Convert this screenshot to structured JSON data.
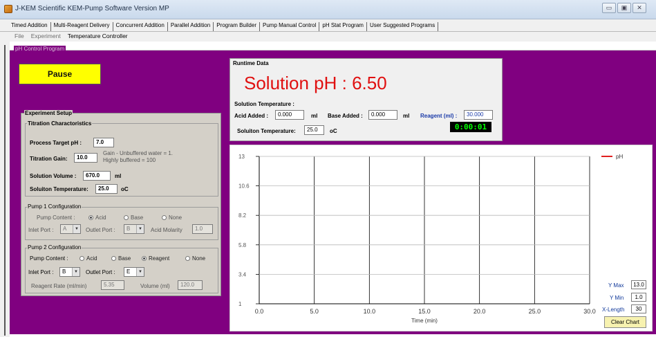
{
  "window": {
    "title": "J-KEM Scientific KEM-Pump Software  Version MP",
    "buttons": [
      "▭",
      "▣",
      "✕"
    ]
  },
  "tabs": [
    {
      "label": "Timed Addition"
    },
    {
      "label": "Multi-Reagent Delivery"
    },
    {
      "label": "Concurrent Addition"
    },
    {
      "label": "Parallel Addition"
    },
    {
      "label": "Program Builder"
    },
    {
      "label": "Pump Manual Control"
    },
    {
      "label": "pH Stat Program"
    },
    {
      "label": "User Suggested Programs"
    }
  ],
  "menu": [
    "File",
    "Experiment",
    "Temperature Controller"
  ],
  "group_title": "pH Control Program",
  "pause_label": "Pause",
  "setup": {
    "title": "Experiment Setup",
    "titration": {
      "title": "Titration Charactoristics",
      "target_label": "Process Target pH :",
      "target_value": "7.0",
      "gain_label": "Titration Gain:",
      "gain_value": "10.0",
      "gain_hint_1": "Gain - Unbuffered water = 1.",
      "gain_hint_2": "Highly buffered = 100",
      "volume_label": "Solution Volume :",
      "volume_value": "670.0",
      "volume_unit": "ml",
      "temp_label": "Soluiton Temperature:",
      "temp_value": "25.0",
      "temp_unit": "oC"
    },
    "pump1": {
      "title": "Pump 1 Configuration",
      "content_label": "Pump Content :",
      "options": [
        "Acid",
        "Base",
        "None"
      ],
      "selected": "Acid",
      "inlet_label": "Inlet Port :",
      "inlet_value": "A",
      "outlet_label": "Outlet Port :",
      "outlet_value": "B",
      "molarity_label": "Acid Molarity",
      "molarity_value": "1.0"
    },
    "pump2": {
      "title": "Pump 2 Configuration",
      "content_label": "Pump Content :",
      "options": [
        "Acid",
        "Base",
        "Reagent",
        "None"
      ],
      "selected": "Reagent",
      "inlet_label": "Inlet Port :",
      "inlet_value": "B",
      "outlet_label": "Outlet Port :",
      "outlet_value": "E",
      "rate_label": "Reagent Rate (ml/min)",
      "rate_value": "5.35",
      "volume_label": "Volume (ml)",
      "volume_value": "120.0"
    }
  },
  "runtime": {
    "title": "Runtime Data",
    "ph_text": "Solution pH : 6.50",
    "temp_header": "Solution Temperature :",
    "acid_label": "Acid Added :",
    "acid_value": "0.000",
    "acid_unit": "ml",
    "base_label": "Base Added :",
    "base_value": "0.000",
    "base_unit": "ml",
    "reagent_label": "Reagent (ml) :",
    "reagent_value": "30.000",
    "temp_label": "Soluiton Temperature:",
    "temp_value": "25.0",
    "temp_unit": "oC",
    "timer": "0:00:01"
  },
  "chart_controls": {
    "ymax_label": "Y Max",
    "ymax_value": "13.0",
    "ymin_label": "Y Min",
    "ymin_value": "1.0",
    "xlen_label": "X-Length",
    "xlen_value": "30",
    "clear_label": "Clear Chart"
  },
  "chart_data": {
    "type": "line",
    "title": "",
    "xlabel": "Time (min)",
    "ylabel": "",
    "xlim": [
      0,
      30
    ],
    "ylim": [
      1,
      13
    ],
    "x_ticks": [
      "0.0",
      "5.0",
      "10.0",
      "15.0",
      "20.0",
      "25.0",
      "30.0"
    ],
    "y_ticks": [
      "1",
      "3.4",
      "5.8",
      "8.2",
      "10.6",
      "13"
    ],
    "grid": true,
    "legend": "top-right",
    "series": [
      {
        "name": "pH",
        "color": "#e02020",
        "x": [],
        "y": []
      }
    ]
  }
}
